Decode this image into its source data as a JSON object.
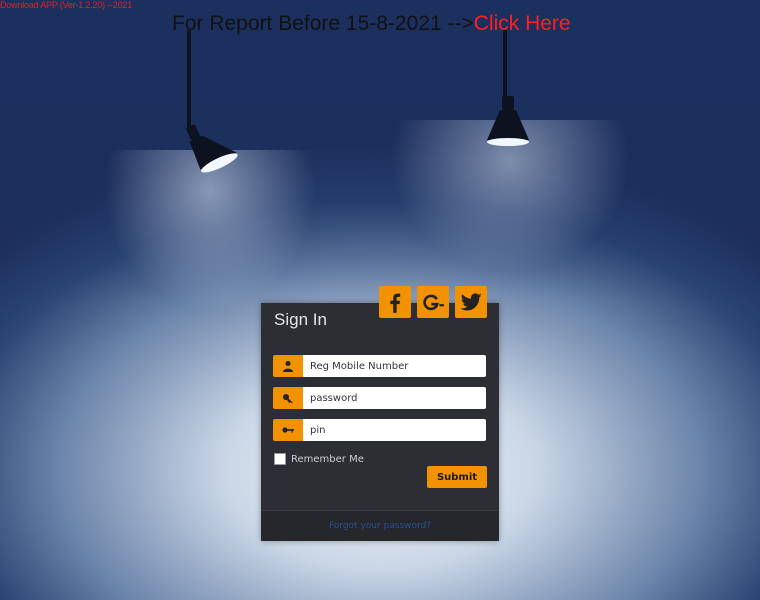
{
  "top_bar": {
    "download_link": "Download APP (Ver-1.2.20) --2021",
    "report_text": "For Report Before 15-8-2021 -->",
    "report_link": "Click Here"
  },
  "login": {
    "title": "Sign In",
    "social": [
      {
        "name": "facebook-icon"
      },
      {
        "name": "google-plus-icon"
      },
      {
        "name": "twitter-icon"
      }
    ],
    "fields": {
      "mobile_placeholder": "Reg Mobile Number",
      "password_placeholder": "password",
      "pin_placeholder": "pin"
    },
    "remember_label": "Remember Me",
    "submit_label": "Submit",
    "forgot_link": "Forgot your password?"
  },
  "colors": {
    "accent": "#f39200",
    "panel": "#2d2e33",
    "link_red": "#ff1e1e",
    "footer_link": "#2a4e9a"
  }
}
